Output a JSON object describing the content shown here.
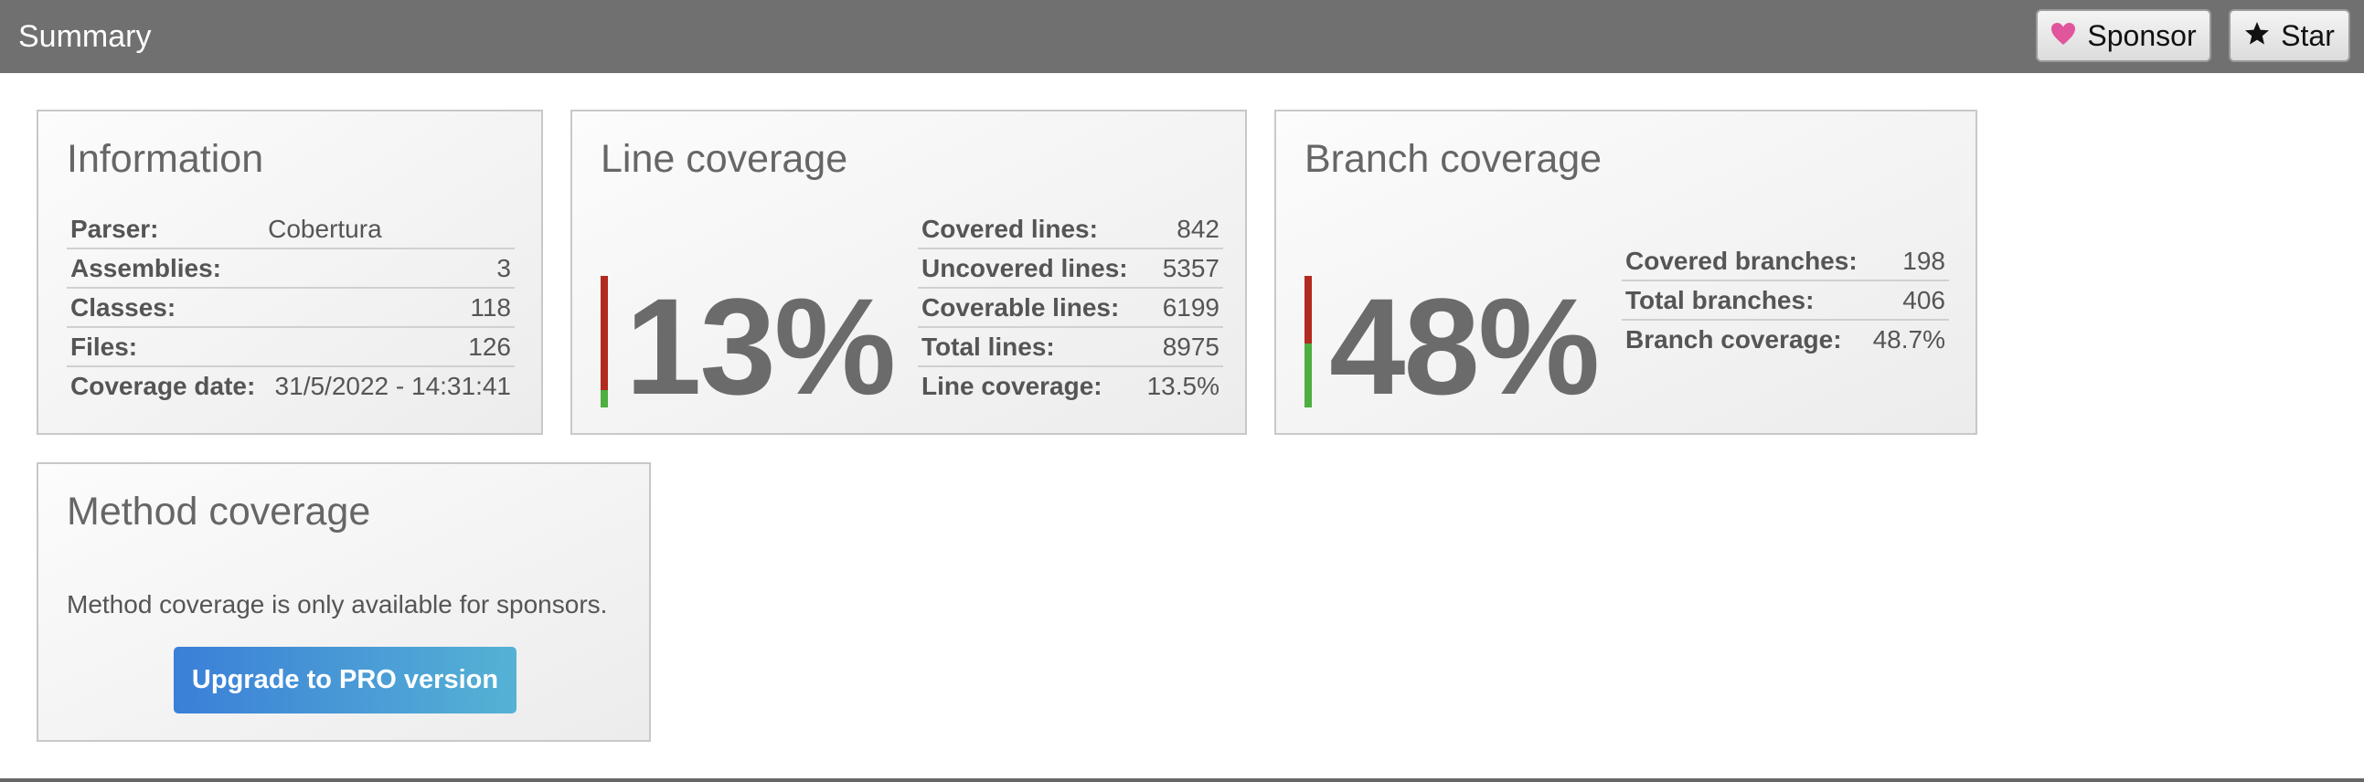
{
  "header": {
    "title": "Summary",
    "sponsor_label": "Sponsor",
    "star_label": "Star",
    "sponsor_icon": "heart-icon",
    "star_icon": "star-icon",
    "sponsor_icon_color": "#e0559b"
  },
  "information": {
    "title": "Information",
    "rows": [
      {
        "label": "Parser:",
        "value": "Cobertura"
      },
      {
        "label": "Assemblies:",
        "value": "3"
      },
      {
        "label": "Classes:",
        "value": "118"
      },
      {
        "label": "Files:",
        "value": "126"
      },
      {
        "label": "Coverage date:",
        "value": "31/5/2022 - 14:31:41"
      }
    ]
  },
  "line_coverage": {
    "title": "Line coverage",
    "percent_text": "13%",
    "coverage_fraction": 0.135,
    "rows": [
      {
        "label": "Covered lines:",
        "value": "842"
      },
      {
        "label": "Uncovered lines:",
        "value": "5357"
      },
      {
        "label": "Coverable lines:",
        "value": "6199"
      },
      {
        "label": "Total lines:",
        "value": "8975"
      },
      {
        "label": "Line coverage:",
        "value": "13.5%"
      }
    ]
  },
  "branch_coverage": {
    "title": "Branch coverage",
    "percent_text": "48%",
    "coverage_fraction": 0.487,
    "rows": [
      {
        "label": "Covered branches:",
        "value": "198"
      },
      {
        "label": "Total branches:",
        "value": "406"
      },
      {
        "label": "Branch coverage:",
        "value": "48.7%"
      }
    ]
  },
  "method_coverage": {
    "title": "Method coverage",
    "message": "Method coverage is only available for sponsors.",
    "upgrade_label": "Upgrade to PRO version"
  },
  "colors": {
    "covered": "#4caf3f",
    "uncovered": "#b22a1f",
    "header_bg": "#707070"
  }
}
